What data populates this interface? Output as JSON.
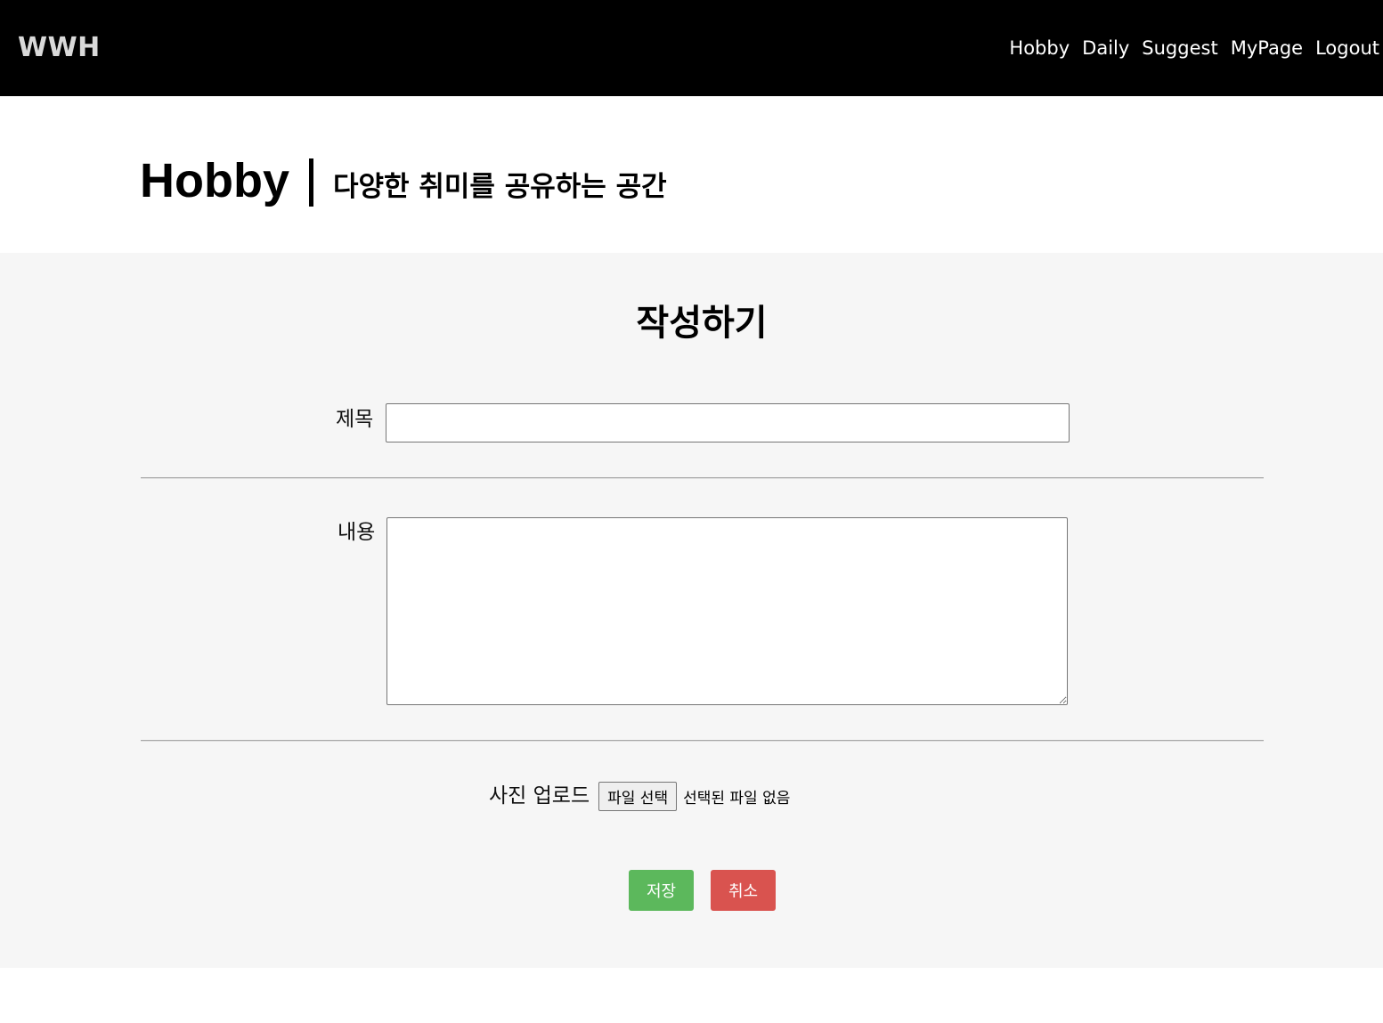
{
  "brand": "WWH",
  "nav": {
    "items": [
      "Hobby",
      "Daily",
      "Suggest",
      "MyPage",
      "Logout"
    ]
  },
  "header": {
    "title": "Hobby",
    "subtitle": "다양한 취미를 공유하는 공간"
  },
  "form": {
    "heading": "작성하기",
    "title_label": "제목",
    "title_value": "",
    "content_label": "내용",
    "content_value": "",
    "upload_label": "사진 업로드",
    "file_button_label": "파일 선택",
    "file_status": "선택된 파일 없음",
    "save_label": "저장",
    "cancel_label": "취소"
  },
  "colors": {
    "navbar_bg": "#000000",
    "form_bg": "#f6f6f6",
    "save_button": "#5cb85c",
    "cancel_button": "#d9534f"
  }
}
